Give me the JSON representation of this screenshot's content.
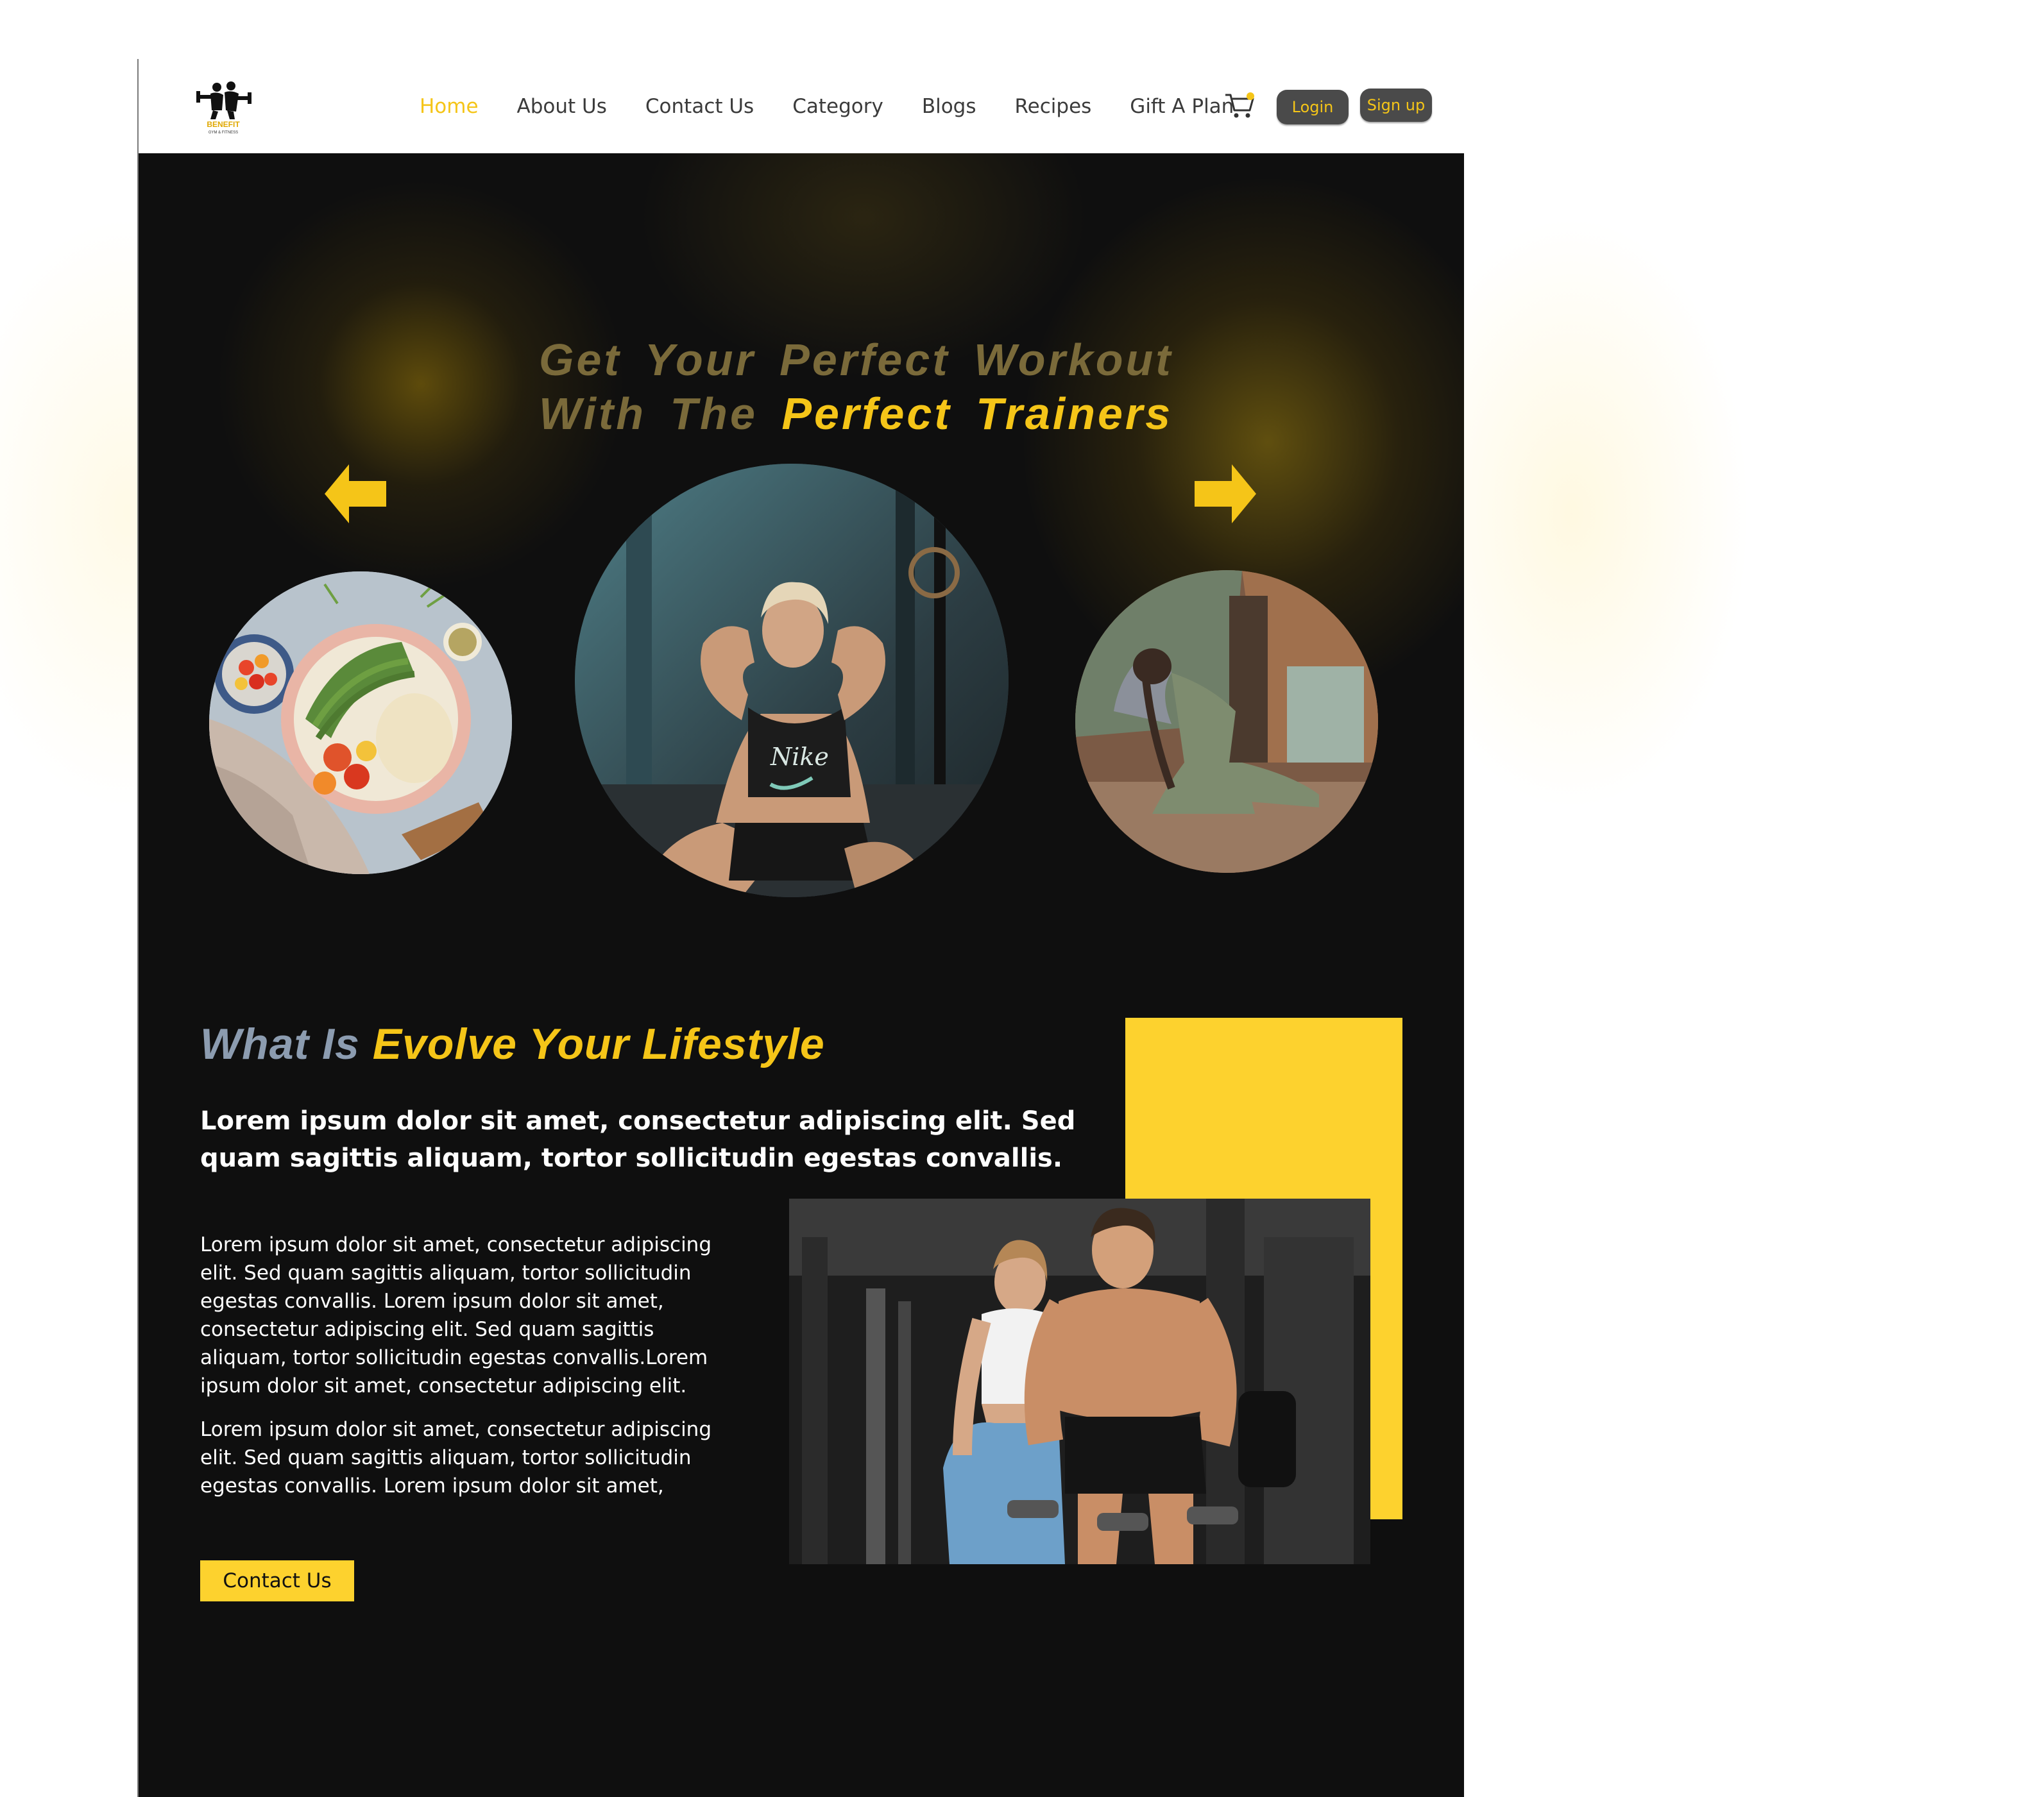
{
  "header": {
    "logo_text": "BENEFIT",
    "logo_subtext": "GYM & FITNESS",
    "nav": [
      {
        "label": "Home",
        "active": true
      },
      {
        "label": "About Us",
        "active": false
      },
      {
        "label": "Contact Us",
        "active": false
      },
      {
        "label": "Category",
        "active": false
      },
      {
        "label": "Blogs",
        "active": false
      },
      {
        "label": "Recipes",
        "active": false
      },
      {
        "label": "Gift A Plan",
        "active": false
      }
    ],
    "cart_icon": "cart-icon",
    "login_label": "Login",
    "signup_label": "Sign up"
  },
  "hero": {
    "line1": "Get Your Perfect Workout",
    "line2_prefix": "With The",
    "line2_highlight": "Perfect Trainers",
    "prev_icon": "arrow-left-icon",
    "next_icon": "arrow-right-icon",
    "shirt_text": "Nike"
  },
  "about": {
    "title_prefix": "What Is",
    "title_highlight": "Evolve Your Lifestyle",
    "lead": "Lorem ipsum dolor sit amet, consectetur adipiscing elit. Sed quam sagittis aliquam, tortor sollicitudin egestas convallis.",
    "paragraph1": "Lorem ipsum dolor sit amet, consectetur adipiscing elit. Sed quam sagittis aliquam, tortor sollicitudin egestas convallis. Lorem ipsum dolor sit amet, consectetur adipiscing elit. Sed quam sagittis aliquam, tortor sollicitudin egestas convallis.Lorem ipsum dolor sit amet, consectetur adipiscing elit.",
    "paragraph2": "Lorem ipsum dolor sit amet, consectetur adipiscing elit. Sed quam sagittis aliquam, tortor sollicitudin egestas convallis. Lorem ipsum dolor sit amet,",
    "cta_label": "Contact Us"
  },
  "colors": {
    "accent": "#f5c518",
    "button_yellow": "#fdd22e",
    "dark_bg": "#0f0f0f",
    "muted_title": "#8c9cb0"
  }
}
